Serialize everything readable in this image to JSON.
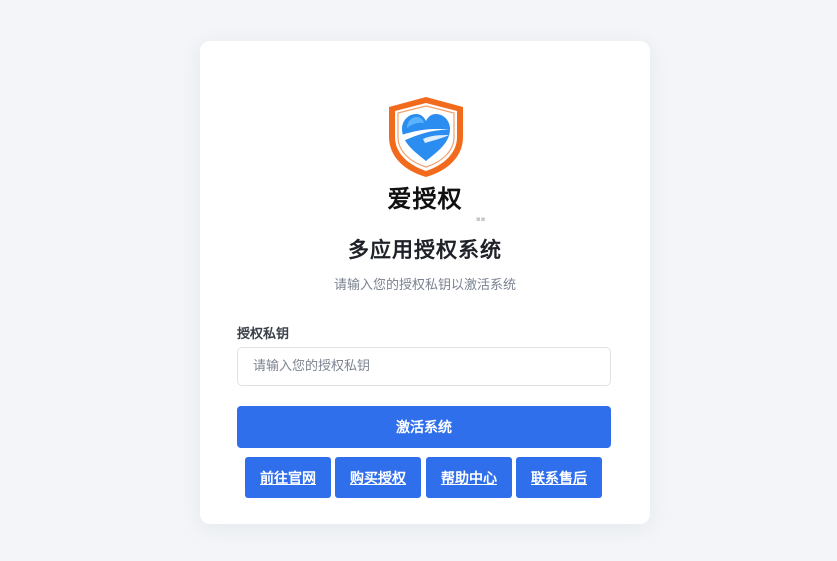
{
  "logo": {
    "icon": "heart-shield-icon",
    "brand_text": "爱授权",
    "colors": {
      "shield_orange": "#f26a1b",
      "heart_blue": "#2b8df0",
      "heart_light": "#5fb7ff"
    }
  },
  "page": {
    "title": "多应用授权系统",
    "subtitle": "请输入您的授权私钥以激活系统"
  },
  "form": {
    "key_label": "授权私钥",
    "key_value": "",
    "key_placeholder": "请输入您的授权私钥",
    "activate_label": "激活系统"
  },
  "links": [
    {
      "label": "前往官网"
    },
    {
      "label": "购买授权"
    },
    {
      "label": "帮助中心"
    },
    {
      "label": "联系售后"
    }
  ],
  "colors": {
    "accent": "#2f6fec",
    "background": "#f3f5f8",
    "card": "#ffffff"
  }
}
